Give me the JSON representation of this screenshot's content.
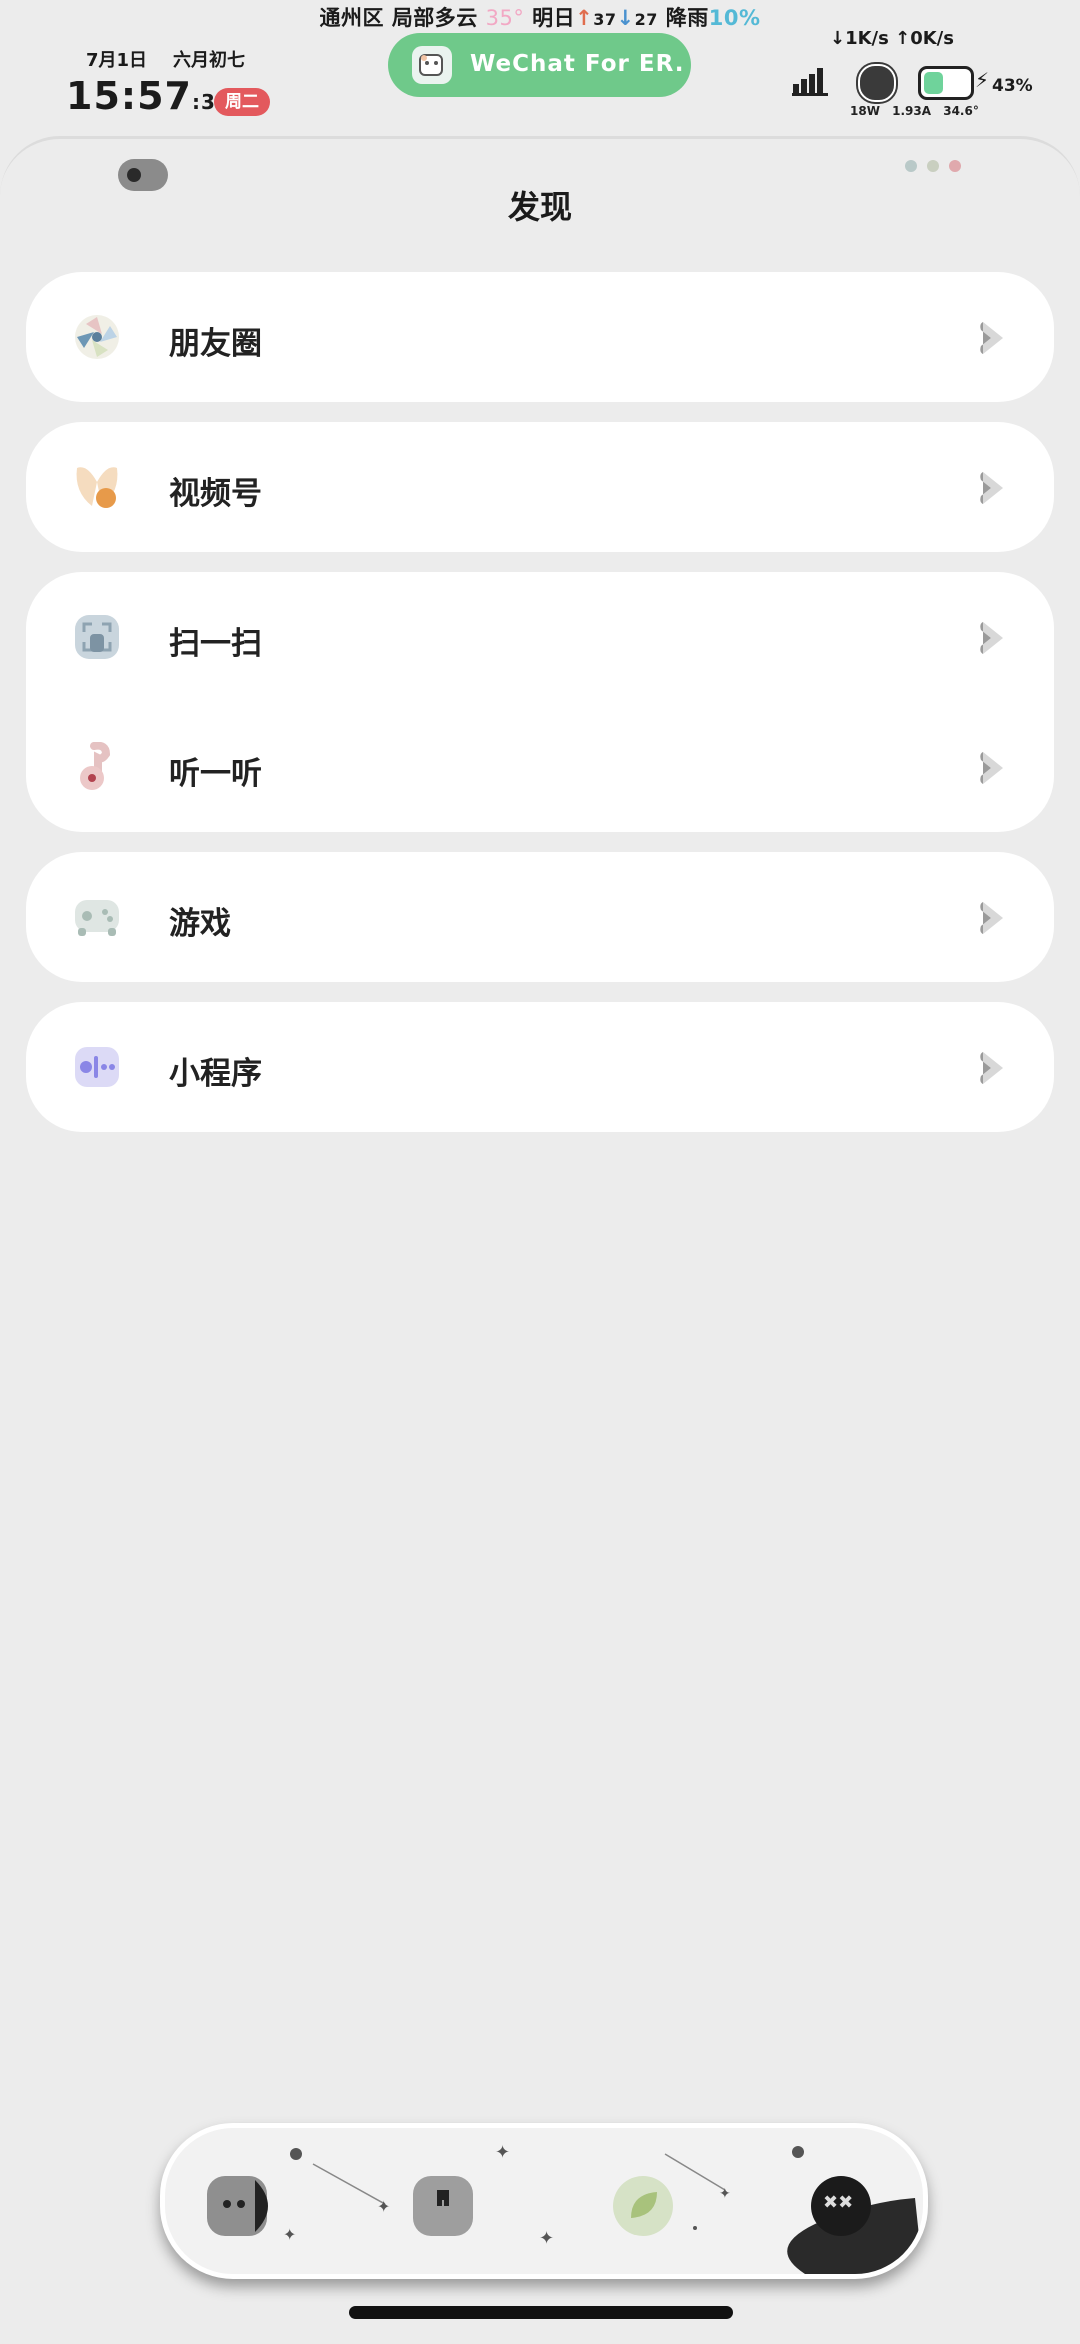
{
  "status_bar": {
    "weather": {
      "district": "通州区",
      "condition": "局部多云",
      "temp": "35°",
      "tomorrow_label": "明日",
      "high_arrow": "↑",
      "high": "37",
      "low_arrow": "↓",
      "low": "27",
      "rain_label": "降雨",
      "rain_pct": "10%"
    },
    "date": "7月1日",
    "lunar_date": "六月初七",
    "time_main": "15:57",
    "time_seconds": ":32",
    "weekday": "周二",
    "app_pill_label": "WeChat For ER.",
    "network_speed": "↓1K/s ↑0K/s",
    "battery_percent": "43%",
    "battery_level": 0.43,
    "stat_power": "18W",
    "stat_current": "1.93A",
    "stat_temp": "34.6°"
  },
  "page": {
    "title": "发现"
  },
  "menu": {
    "moments": "朋友圈",
    "channels": "视频号",
    "scan": "扫一扫",
    "listen": "听一听",
    "games": "游戏",
    "mini_programs": "小程序"
  },
  "colors": {
    "background": "#ececec",
    "card": "#ffffff",
    "pill": "#6fc98a",
    "weekday_badge": "#e3595d",
    "mini_program_icon": "#8a86e6"
  },
  "icons": {
    "moments": "aperture-icon",
    "channels": "butterfly-icon",
    "scan": "scan-icon",
    "listen": "music-note-icon",
    "games": "gamepad-icon",
    "mini_programs": "mini-program-icon",
    "chevron": "chevron-right-icon"
  }
}
